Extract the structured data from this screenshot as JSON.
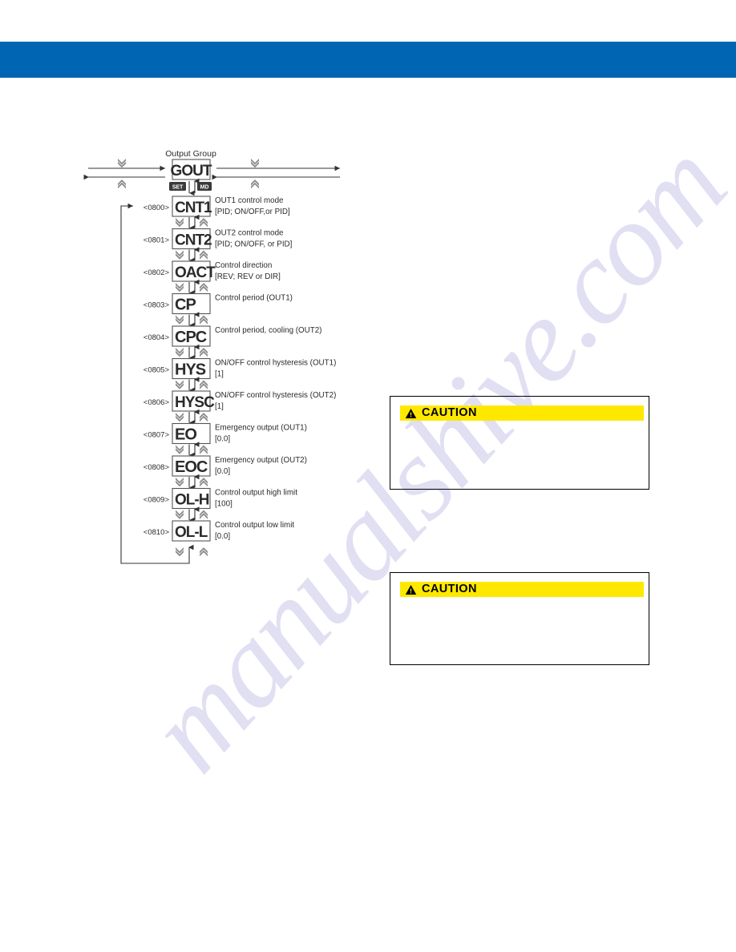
{
  "page": {
    "watermark": "manualshive.com",
    "header_band_color": "#0066b3",
    "caution_bar_color": "#ffe800"
  },
  "diagram": {
    "group_title": "Output Group",
    "group_display": "GOUT",
    "set_button": "SET",
    "md_button": "MD",
    "rows": [
      {
        "code": "<0800>",
        "display": "CNT1",
        "label": "OUT1 control mode",
        "value": "[PID; ON/OFF,or PID]"
      },
      {
        "code": "<0801>",
        "display": "CNT2",
        "label": "OUT2 control mode",
        "value": "[PID; ON/OFF, or PID]"
      },
      {
        "code": "<0802>",
        "display": "OACT",
        "label": "Control direction",
        "value": "[REV; REV or DIR]"
      },
      {
        "code": "<0803>",
        "display": "CP",
        "label": "Control period (OUT1)",
        "value": ""
      },
      {
        "code": "<0804>",
        "display": "CPC",
        "label": "Control period, cooling (OUT2)",
        "value": ""
      },
      {
        "code": "<0805>",
        "display": "HYS",
        "label": "ON/OFF control hysteresis (OUT1)",
        "value": "[1]"
      },
      {
        "code": "<0806>",
        "display": "HYSC",
        "label": "ON/OFF control hysteresis (OUT2)",
        "value": "[1]"
      },
      {
        "code": "<0807>",
        "display": "EO",
        "label": "Emergency output (OUT1)",
        "value": "[0.0]"
      },
      {
        "code": "<0808>",
        "display": "EOC",
        "label": "Emergency output (OUT2)",
        "value": "[0.0]"
      },
      {
        "code": "<0809>",
        "display": "OL-H",
        "label": "Control output high limit",
        "value": "[100]"
      },
      {
        "code": "<0810>",
        "display": "OL-L",
        "label": "Control output low limit",
        "value": "[0.0]"
      }
    ]
  },
  "cautions": [
    {
      "label": "CAUTION",
      "body": ""
    },
    {
      "label": "CAUTION",
      "body": ""
    }
  ]
}
